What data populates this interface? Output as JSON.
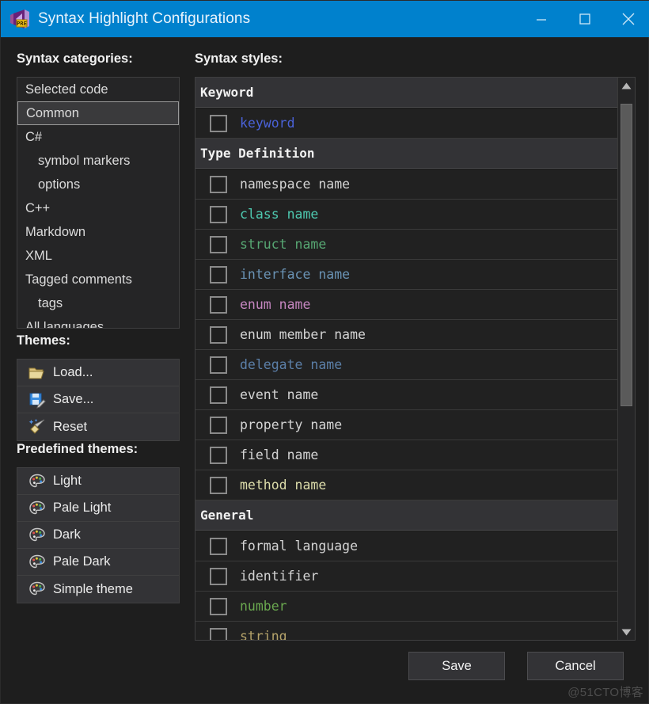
{
  "window": {
    "title": "Syntax Highlight Configurations",
    "icon": "visual-studio-preview-icon",
    "minimize_label": "—",
    "maximize_label": "□",
    "close_label": "✕",
    "titlebar_color": "#0081cd"
  },
  "labels": {
    "categories": "Syntax categories:",
    "styles": "Syntax styles:",
    "themes": "Themes:",
    "predefined": "Predefined themes:"
  },
  "categories": {
    "selected": "Common",
    "items": [
      {
        "label": "Selected code",
        "indent": 0,
        "selected": false
      },
      {
        "label": "Common",
        "indent": 0,
        "selected": true
      },
      {
        "label": "C#",
        "indent": 0,
        "selected": false
      },
      {
        "label": "symbol markers",
        "indent": 1,
        "selected": false
      },
      {
        "label": "options",
        "indent": 1,
        "selected": false
      },
      {
        "label": "C++",
        "indent": 0,
        "selected": false
      },
      {
        "label": "Markdown",
        "indent": 0,
        "selected": false
      },
      {
        "label": "XML",
        "indent": 0,
        "selected": false
      },
      {
        "label": "Tagged comments",
        "indent": 0,
        "selected": false
      },
      {
        "label": "tags",
        "indent": 1,
        "selected": false
      },
      {
        "label": "All languages",
        "indent": 0,
        "selected": false
      }
    ]
  },
  "themes": {
    "buttons": [
      {
        "label": "Load...",
        "icon": "folder-open-icon"
      },
      {
        "label": "Save...",
        "icon": "floppy-disk-edit-icon"
      },
      {
        "label": "Reset",
        "icon": "broom-sparkle-icon"
      }
    ]
  },
  "predefined_themes": {
    "buttons": [
      {
        "label": "Light",
        "icon": "palette-icon"
      },
      {
        "label": "Pale Light",
        "icon": "palette-icon"
      },
      {
        "label": "Dark",
        "icon": "palette-icon"
      },
      {
        "label": "Pale Dark",
        "icon": "palette-icon"
      },
      {
        "label": "Simple theme",
        "icon": "palette-icon"
      }
    ]
  },
  "styles": {
    "groups": [
      {
        "title": "Keyword",
        "rows": [
          {
            "label": "keyword",
            "color": "#4a62d8",
            "checked": false
          }
        ]
      },
      {
        "title": "Type Definition",
        "rows": [
          {
            "label": "namespace name",
            "color": "#d4d4d4",
            "checked": false
          },
          {
            "label": "class name",
            "color": "#4ec9b0",
            "checked": false
          },
          {
            "label": "struct name",
            "color": "#57a773",
            "checked": false
          },
          {
            "label": "interface name",
            "color": "#6a93b5",
            "checked": false
          },
          {
            "label": "enum name",
            "color": "#c586c0",
            "checked": false
          },
          {
            "label": "enum member name",
            "color": "#d4d4d4",
            "checked": false
          },
          {
            "label": "delegate name",
            "color": "#5b7fa8",
            "checked": false
          },
          {
            "label": "event name",
            "color": "#d4d4d4",
            "checked": false
          },
          {
            "label": "property name",
            "color": "#d4d4d4",
            "checked": false
          },
          {
            "label": "field name",
            "color": "#d4d4d4",
            "checked": false
          },
          {
            "label": "method name",
            "color": "#dcdcaa",
            "checked": false
          }
        ]
      },
      {
        "title": "General",
        "rows": [
          {
            "label": "formal language",
            "color": "#d4d4d4",
            "checked": false
          },
          {
            "label": "identifier",
            "color": "#d4d4d4",
            "checked": false
          },
          {
            "label": "number",
            "color": "#6aa84f",
            "checked": false
          },
          {
            "label": "string",
            "color": "#b5a36a",
            "checked": false
          }
        ]
      }
    ]
  },
  "scrollbar": {
    "up_arrow": "scroll-up-arrow",
    "down_arrow": "scroll-down-arrow",
    "thumb_top_pct": 2,
    "thumb_height_pct": 57
  },
  "footer": {
    "save_label": "Save",
    "cancel_label": "Cancel"
  },
  "watermark": "@51CTO博客"
}
